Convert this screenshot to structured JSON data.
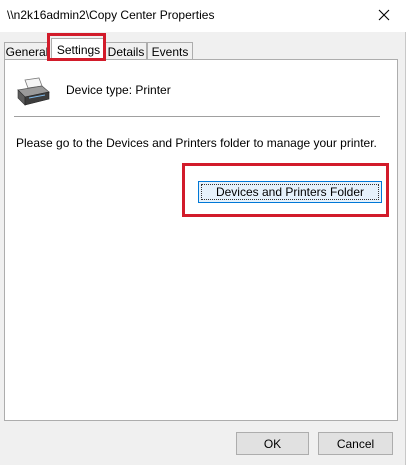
{
  "window": {
    "title": "\\\\n2k16admin2\\Copy Center Properties"
  },
  "tabs": [
    {
      "label": "General"
    },
    {
      "label": "Settings"
    },
    {
      "label": "Details"
    },
    {
      "label": "Events"
    }
  ],
  "active_tab": "Settings",
  "settings": {
    "device_type": "Device type: Printer",
    "info_text": "Please go to the Devices and Printers folder to manage your printer.",
    "folder_button_label": "Devices and Printers Folder"
  },
  "buttons": {
    "ok": "OK",
    "cancel": "Cancel"
  },
  "icons": {
    "close": "close-icon",
    "printer": "printer-icon"
  },
  "colors": {
    "highlight": "#d21b2a",
    "focus_border": "#0078d7"
  }
}
